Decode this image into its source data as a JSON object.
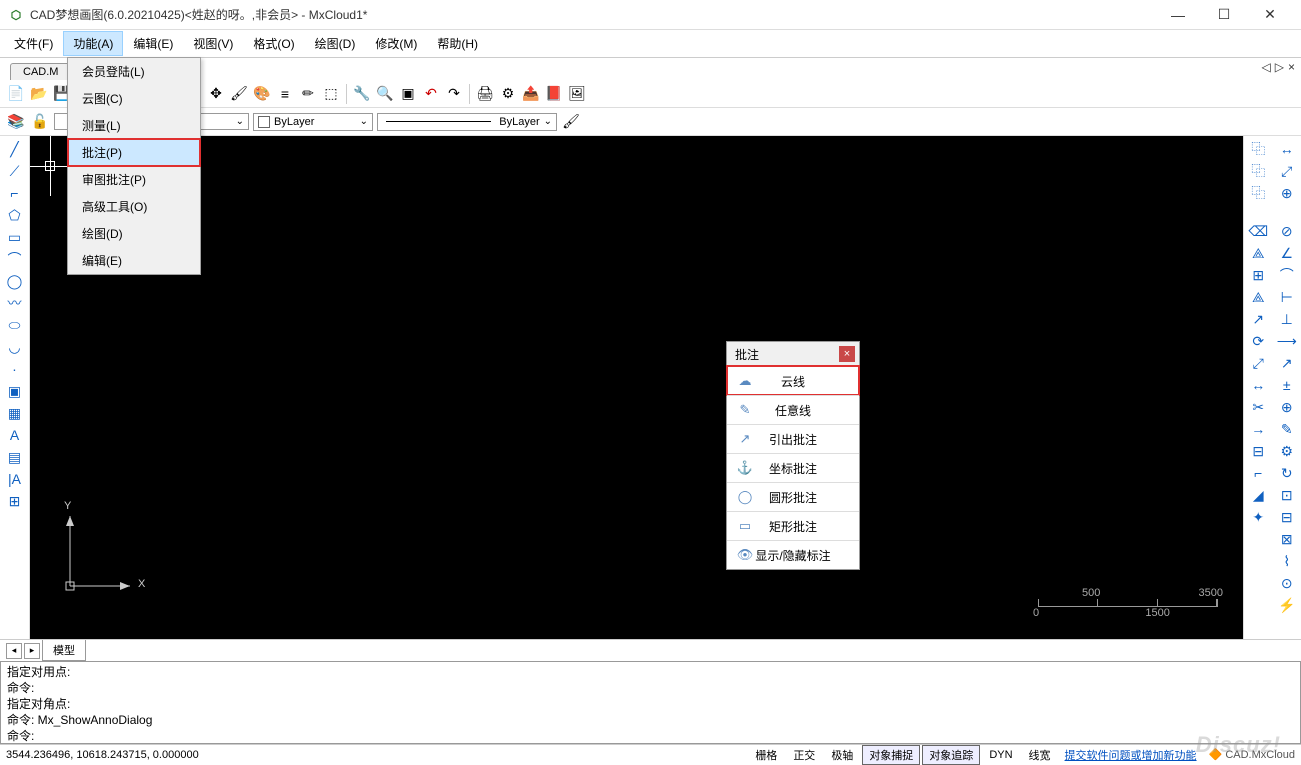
{
  "window": {
    "title": "CAD梦想画图(6.0.20210425)<姓赵的呀。,非会员> - MxCloud1*"
  },
  "menubar": [
    "文件(F)",
    "功能(A)",
    "编辑(E)",
    "视图(V)",
    "格式(O)",
    "绘图(D)",
    "修改(M)",
    "帮助(H)"
  ],
  "active_menu_index": 1,
  "dropdown": {
    "items": [
      "会员登陆(L)",
      "云图(C)",
      "测量(L)",
      "批注(P)",
      "审图批注(P)",
      "高级工具(O)",
      "绘图(D)",
      "编辑(E)"
    ],
    "highlighted_index": 3
  },
  "tabs": {
    "doc": "CAD.M"
  },
  "tab_right": [
    "◁",
    "▷",
    "×"
  ],
  "combos": {
    "layer": "",
    "color": "ByLayer",
    "linetype": "ByLayer"
  },
  "anno_panel": {
    "title": "批注",
    "items": [
      {
        "icon": "☁",
        "label": "云线",
        "highlight": true
      },
      {
        "icon": "✎",
        "label": "任意线"
      },
      {
        "icon": "↗",
        "label": "引出批注"
      },
      {
        "icon": "⚓",
        "label": "坐标批注"
      },
      {
        "icon": "◯",
        "label": "圆形批注"
      },
      {
        "icon": "▭",
        "label": "矩形批注"
      },
      {
        "icon": "👁",
        "label": "显示/隐藏标注"
      }
    ]
  },
  "ucs": {
    "x": "X",
    "y": "Y"
  },
  "scale": {
    "t1": "500",
    "t2": "3500",
    "b1": "0",
    "b2": "1500"
  },
  "bottom_tab": "模型",
  "cmd": {
    "l1": "指定对用点:",
    "l2": "命令:",
    "l3": "指定对角点:",
    "l4": "命令: Mx_ShowAnnoDialog",
    "l5": "命令:"
  },
  "status": {
    "coords": "3544.236496,  10618.243715,  0.000000",
    "buttons": [
      "栅格",
      "正交",
      "极轴",
      "对象捕捉",
      "对象追踪",
      "DYN",
      "线宽"
    ],
    "active_buttons": [
      3,
      4
    ],
    "link": "提交软件问题或增加新功能",
    "logo": "CAD.MxCloud"
  },
  "watermark": "Discuz!"
}
